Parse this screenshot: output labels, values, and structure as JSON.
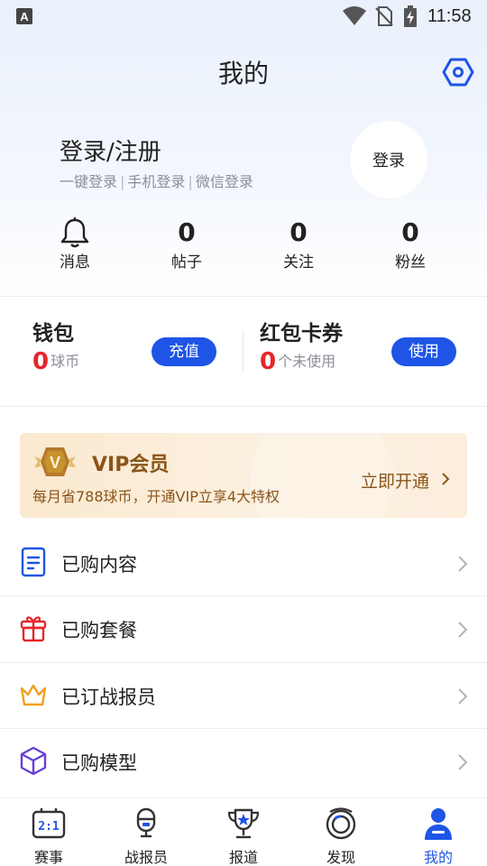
{
  "status_bar": {
    "time": "11:58",
    "app_icon_letter": "A"
  },
  "header": {
    "title": "我的",
    "settings_icon": "hexagon-settings-icon"
  },
  "login": {
    "title": "登录/注册",
    "options": [
      "一键登录",
      "手机登录",
      "微信登录"
    ],
    "separator": "|",
    "button_label": "登录"
  },
  "stats": [
    {
      "label": "消息",
      "icon": "bell-icon"
    },
    {
      "label": "帖子",
      "value": "0"
    },
    {
      "label": "关注",
      "value": "0"
    },
    {
      "label": "粉丝",
      "value": "0"
    }
  ],
  "wallet": {
    "title": "钱包",
    "value": "0",
    "unit": "球币",
    "button_label": "充值"
  },
  "coupons": {
    "title": "红包卡券",
    "value": "0",
    "unit": "个未使用",
    "button_label": "使用"
  },
  "vip": {
    "badge_letter": "V",
    "title": "VIP会员",
    "description": "每月省788球币，开通VIP立享4大特权",
    "cta": "立即开通"
  },
  "menu": [
    {
      "label": "已购内容",
      "icon": "document-icon"
    },
    {
      "label": "已购套餐",
      "icon": "gift-icon"
    },
    {
      "label": "已订战报员",
      "icon": "crown-icon"
    },
    {
      "label": "已购模型",
      "icon": "cube-icon"
    }
  ],
  "bottom_nav": [
    {
      "label": "赛事",
      "icon": "scoreboard-icon",
      "icon_text": "2:1"
    },
    {
      "label": "战报员",
      "icon": "reporter-icon"
    },
    {
      "label": "报道",
      "icon": "trophy-icon"
    },
    {
      "label": "发现",
      "icon": "discover-icon"
    },
    {
      "label": "我的",
      "icon": "user-icon",
      "active": true
    }
  ],
  "colors": {
    "accent": "#1e55e6",
    "red": "#e6262b",
    "vip_text": "#8a5418",
    "vip_bg": "#fbe9cf"
  }
}
